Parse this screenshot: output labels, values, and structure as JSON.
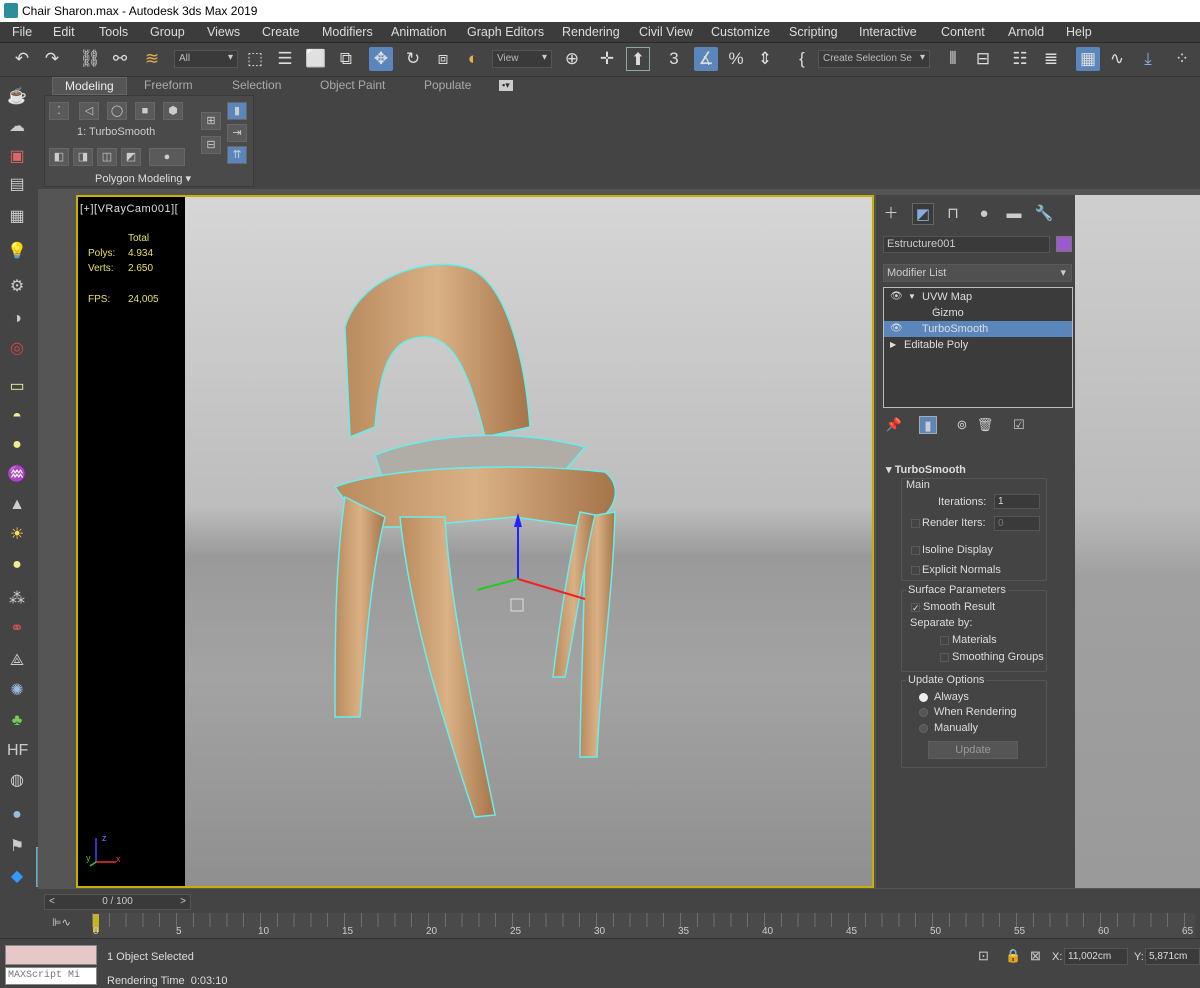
{
  "window": {
    "title": "Chair Sharon.max - Autodesk 3ds Max 2019"
  },
  "menu": [
    "File",
    "Edit",
    "Tools",
    "Group",
    "Views",
    "Create",
    "Modifiers",
    "Animation",
    "Graph Editors",
    "Rendering",
    "Civil View",
    "Customize",
    "Scripting",
    "Interactive",
    "Content",
    "Arnold",
    "Help"
  ],
  "toolbar": {
    "filter_value": "All",
    "ref_coord_value": "View",
    "selection_set_placeholder": "Create Selection Se",
    "icons": [
      "undo-icon",
      "redo-icon",
      "link-icon",
      "unlink-icon",
      "bind-space-warp-icon",
      "select-object-icon",
      "select-by-name-icon",
      "rect-selection-region-icon",
      "window-crossing-icon",
      "select-move-icon",
      "select-rotate-icon",
      "select-scale-icon",
      "place-icon",
      "pivot-center-icon",
      "manipulate-icon",
      "snaps-toggle-icon",
      "angle-snap-icon",
      "percent-snap-icon",
      "spinner-snap-icon",
      "edit-named-sets-icon",
      "mirror-icon",
      "align-icon",
      "scene-explorer-icon",
      "layer-explorer-icon",
      "ribbon-toggle-icon",
      "curve-editor-icon",
      "schematic-view-icon"
    ]
  },
  "ribbon": {
    "tabs": [
      "Modeling",
      "Freeform",
      "Selection",
      "Object Paint",
      "Populate"
    ],
    "active_tab": "Modeling",
    "modifier_label": "1: TurboSmooth",
    "panel_label": "Polygon Modeling"
  },
  "left_icons": [
    "teapot-icon",
    "cloud-icon",
    "render-frame-icon",
    "material-editor-icon",
    "sphere-icon",
    "light-icon",
    "camera-icon",
    "helper-icon",
    "space-warp-icon",
    "box-icon",
    "hemisphere-icon",
    "sphere-icon",
    "grass-icon",
    "cone-icon",
    "sun-icon",
    "sphere-icon",
    "particle-icon",
    "bone-icon",
    "mesh-icon",
    "gear-icon",
    "plant-icon",
    "hair-icon",
    "fur-icon"
  ],
  "viewport": {
    "label": "[+][VRayCam001][",
    "stats": {
      "header": "Total",
      "polys_label": "Polys:",
      "polys_value": "4.934",
      "verts_label": "Verts:",
      "verts_value": "2.650",
      "fps_label": "FPS:",
      "fps_value": "24,005"
    },
    "axis_x": "x",
    "axis_y": "y",
    "axis_z": "z"
  },
  "command_panel": {
    "tab_icons": [
      "create-icon",
      "modify-icon",
      "hierarchy-icon",
      "motion-icon",
      "display-icon",
      "utilities-icon"
    ],
    "object_name": "Estructure001",
    "object_color": "#9b59d0",
    "modifier_list_label": "Modifier List",
    "stack": [
      {
        "label": "UVW Map",
        "expanded": true,
        "selected": false
      },
      {
        "label": "Gizmo",
        "sub": true
      },
      {
        "label": "TurboSmooth",
        "selected": true
      },
      {
        "label": "Editable Poly",
        "collapsed": true
      }
    ],
    "stack_tool_icons": [
      "pin-stack-icon",
      "show-end-result-icon",
      "make-unique-icon",
      "remove-modifier-icon",
      "configure-sets-icon"
    ]
  },
  "turbosmooth": {
    "title": "TurboSmooth",
    "main_label": "Main",
    "iterations_label": "Iterations:",
    "iterations_value": "1",
    "render_iters_label": "Render Iters:",
    "render_iters_value": "0",
    "render_iters_checked": false,
    "isoline_label": "Isoline Display",
    "isoline_checked": false,
    "explicit_normals_label": "Explicit Normals",
    "explicit_normals_checked": false,
    "surface_label": "Surface Parameters",
    "smooth_result_label": "Smooth Result",
    "smooth_result_checked": true,
    "separate_by_label": "Separate by:",
    "materials_label": "Materials",
    "materials_checked": false,
    "smoothing_groups_label": "Smoothing Groups",
    "smoothing_groups_checked": false,
    "update_options_label": "Update Options",
    "always_label": "Always",
    "when_rendering_label": "When Rendering",
    "manually_label": "Manually",
    "update_mode": "Always",
    "update_button": "Update"
  },
  "timeline": {
    "slider_label": "0 / 100",
    "prev": "<",
    "next": ">",
    "ticks": [
      "0",
      "5",
      "10",
      "15",
      "20",
      "25",
      "30",
      "35",
      "40",
      "45",
      "50",
      "55",
      "60",
      "65"
    ]
  },
  "status": {
    "maxscript_label": "MAXScript Mi",
    "selection_text": "1 Object Selected",
    "render_time": "Rendering Time  0:03:10",
    "x_label": "X:",
    "x_value": "11,002cm",
    "y_label": "Y:",
    "y_value": "5,871cm"
  }
}
